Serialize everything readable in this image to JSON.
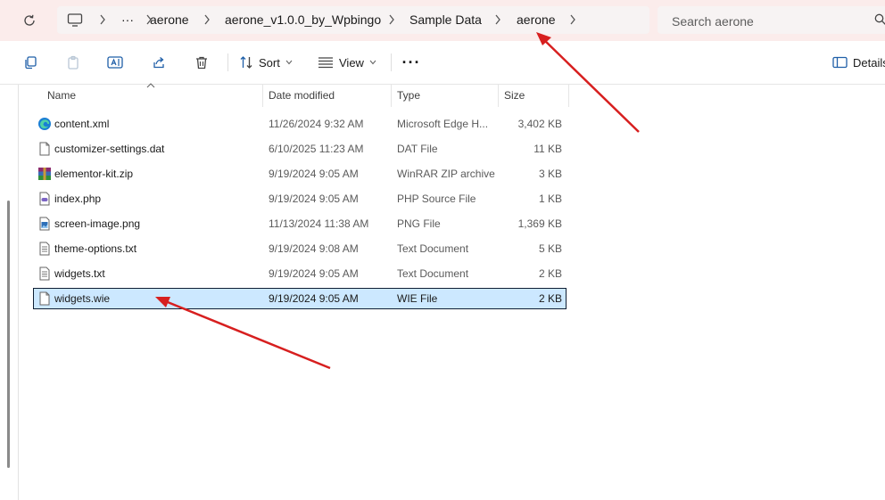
{
  "breadcrumb": {
    "items": [
      "aerone",
      "aerone_v1.0.0_by_Wpbingo",
      "Sample Data",
      "aerone"
    ],
    "overflow": "···"
  },
  "search": {
    "placeholder": "Search aerone"
  },
  "toolbar": {
    "sort_label": "Sort",
    "view_label": "View",
    "more_label": "···",
    "details_label": "Details"
  },
  "columns": {
    "name": "Name",
    "date": "Date modified",
    "type": "Type",
    "size": "Size"
  },
  "files": [
    {
      "name": "content.xml",
      "date": "11/26/2024 9:32 AM",
      "type": "Microsoft Edge H...",
      "size": "3,402 KB",
      "icon": "edge-icon"
    },
    {
      "name": "customizer-settings.dat",
      "date": "6/10/2025 11:23 AM",
      "type": "DAT File",
      "size": "11 KB",
      "icon": "file-icon"
    },
    {
      "name": "elementor-kit.zip",
      "date": "9/19/2024 9:05 AM",
      "type": "WinRAR ZIP archive",
      "size": "3 KB",
      "icon": "winrar-icon"
    },
    {
      "name": "index.php",
      "date": "9/19/2024 9:05 AM",
      "type": "PHP Source File",
      "size": "1 KB",
      "icon": "php-file-icon"
    },
    {
      "name": "screen-image.png",
      "date": "11/13/2024 11:38 AM",
      "type": "PNG File",
      "size": "1,369 KB",
      "icon": "image-file-icon"
    },
    {
      "name": "theme-options.txt",
      "date": "9/19/2024 9:08 AM",
      "type": "Text Document",
      "size": "5 KB",
      "icon": "text-file-icon"
    },
    {
      "name": "widgets.txt",
      "date": "9/19/2024 9:05 AM",
      "type": "Text Document",
      "size": "2 KB",
      "icon": "text-file-icon"
    },
    {
      "name": "widgets.wie",
      "date": "9/19/2024 9:05 AM",
      "type": "WIE File",
      "size": "2 KB",
      "icon": "file-icon",
      "selected": true
    }
  ],
  "colors": {
    "selection_bg": "#cce8ff",
    "annotation_arrow": "#d71f1f",
    "titlebar_bg": "#fbeceb"
  }
}
